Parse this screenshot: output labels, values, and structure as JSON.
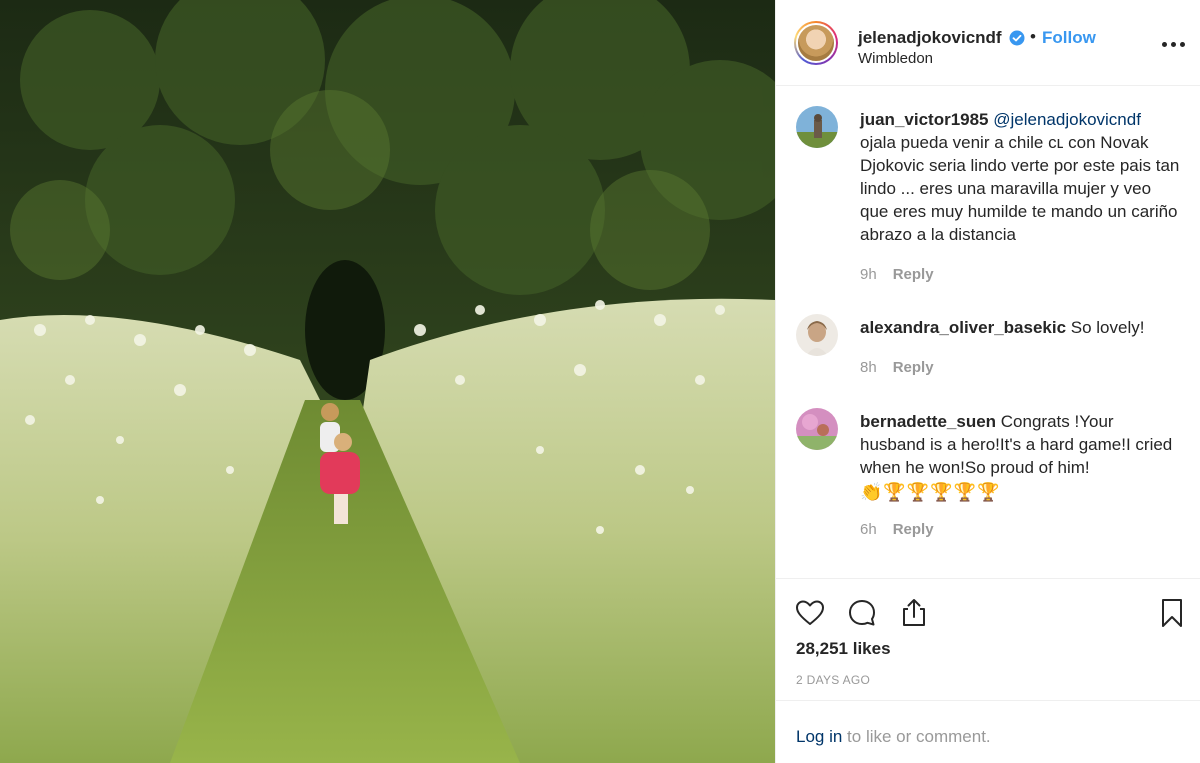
{
  "header": {
    "username": "jelenadjokovicndf",
    "separator": "•",
    "follow_label": "Follow",
    "location": "Wimbledon"
  },
  "comments": [
    {
      "username": "juan_victor1985",
      "mention": "@jelenadjokovicndf",
      "text": "ojala pueda venir a chile cʟ con Novak Djokovic seria lindo verte por este pais tan lindo ... eres una maravilla mujer y veo que eres muy humilde te mando un cariño abrazo a la distancia",
      "time": "9h",
      "reply_label": "Reply"
    },
    {
      "username": "alexandra_oliver_basekic",
      "text": "So lovely!",
      "time": "8h",
      "reply_label": "Reply"
    },
    {
      "username": "bernadette_suen",
      "text": "Congrats !Your husband is a hero!It's a hard game!I cried when he won!So proud of him!",
      "emoji": "👏🏆🏆🏆🏆🏆",
      "time": "6h",
      "reply_label": "Reply"
    }
  ],
  "actions": {
    "likes": "28,251 likes",
    "timestamp": "2 DAYS AGO"
  },
  "login": {
    "link_text": "Log in",
    "rest_text": " to like or comment."
  },
  "icons": {
    "like": "heart-icon",
    "comment": "comment-icon",
    "share": "share-icon",
    "save": "bookmark-icon",
    "verified": "verified-badge-icon",
    "more": "more-options-icon"
  },
  "colors": {
    "accent": "#3897f0",
    "text": "#262626",
    "muted": "#999999",
    "link": "#003569",
    "border": "#efefef"
  }
}
